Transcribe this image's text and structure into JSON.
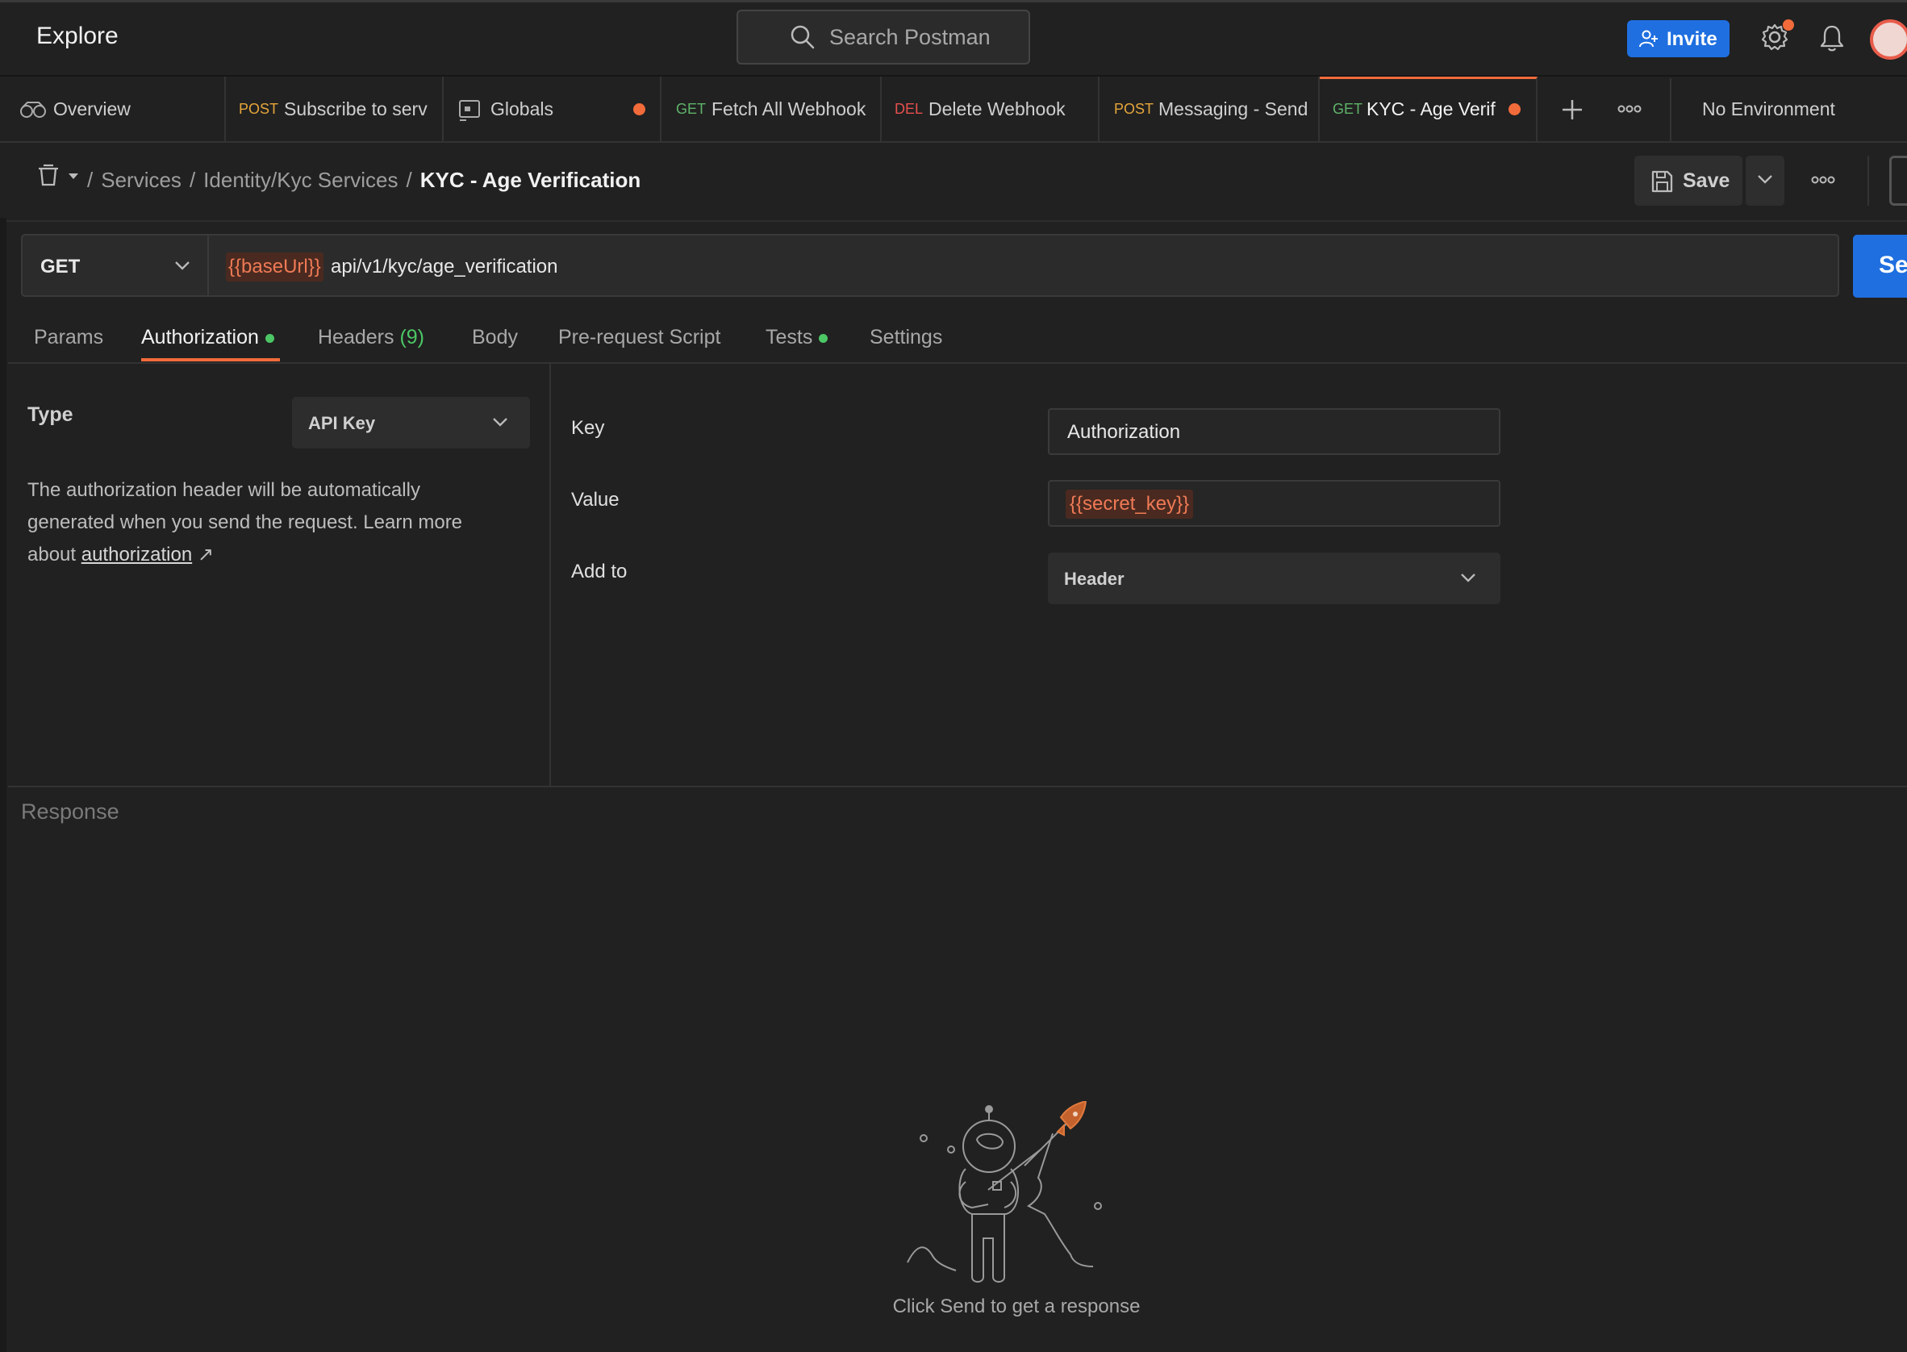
{
  "header": {
    "title": "Explore",
    "search_placeholder": "Search Postman",
    "invite_label": "Invite"
  },
  "tabs": [
    {
      "method": "",
      "title": "Overview"
    },
    {
      "method": "POST",
      "title": "Subscribe to serv"
    },
    {
      "method": "",
      "title": "Globals"
    },
    {
      "method": "GET",
      "title": "Fetch All Webhook"
    },
    {
      "method": "DEL",
      "title": "Delete Webhook"
    },
    {
      "method": "POST",
      "title": "Messaging - Send"
    },
    {
      "method": "GET",
      "title": "KYC - Age Verif"
    }
  ],
  "environment": "No Environment",
  "breadcrumb": {
    "sep": "/",
    "items": [
      "Services",
      "Identity/Kyc Services"
    ],
    "current": "KYC - Age Verification"
  },
  "toolbar": {
    "save_label": "Save"
  },
  "request": {
    "method": "GET",
    "url_var": "{{baseUrl}}",
    "url_path": "api/v1/kyc/age_verification",
    "send_label": "Se"
  },
  "request_tabs": {
    "params": "Params",
    "authorization": "Authorization",
    "headers": "Headers",
    "headers_count": "(9)",
    "body": "Body",
    "prerequest": "Pre-request Script",
    "tests": "Tests",
    "settings": "Settings"
  },
  "auth": {
    "type_label": "Type",
    "type_value": "API Key",
    "help_text": "The authorization header will be automatically generated when you send the request. Learn more about",
    "help_link": "authorization",
    "help_link_arrow": "↗",
    "key_label": "Key",
    "key_value": "Authorization",
    "value_label": "Value",
    "value_value": "{{secret_key}}",
    "addto_label": "Add to",
    "addto_value": "Header"
  },
  "response": {
    "title": "Response",
    "hint": "Click Send to get a response"
  },
  "colors": {
    "accent": "#f26b3a",
    "primary": "#1f6fe0",
    "bg": "#212121",
    "post": "#e6a63a",
    "get": "#5fb36a",
    "del": "#e5504e",
    "ok": "#4cc765"
  }
}
